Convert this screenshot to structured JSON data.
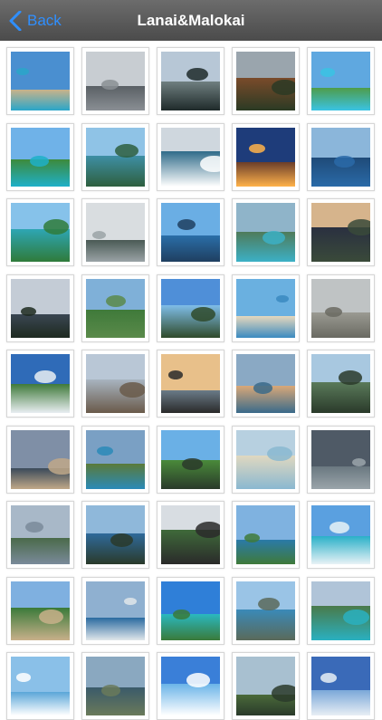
{
  "navbar": {
    "title": "Lanai&Malokai",
    "back_label": "Back",
    "back_icon": "chevron-left-icon",
    "accent_color": "#2f8fff"
  },
  "photos": [
    {
      "sky": "#4a8fd0",
      "land": "#c9b38a",
      "accent": "#2aa6c9"
    },
    {
      "sky": "#c8cdd2",
      "land": "#5a6065",
      "accent": "#8a8f94"
    },
    {
      "sky": "#b7c7d6",
      "land": "#6f7f80",
      "accent": "#1f2a2a"
    },
    {
      "sky": "#9aa5ad",
      "land": "#7a4b2a",
      "accent": "#2b3a24"
    },
    {
      "sky": "#5fa8e0",
      "land": "#4f9c4a",
      "accent": "#3ac3e3"
    },
    {
      "sky": "#6fb2e8",
      "land": "#3d8a3b",
      "accent": "#1fb0c8"
    },
    {
      "sky": "#8fc3e6",
      "land": "#3e8fa4",
      "accent": "#2e5f3e"
    },
    {
      "sky": "#cfd7de",
      "land": "#2f6b8a",
      "accent": "#ffffff"
    },
    {
      "sky": "#1e3c7a",
      "land": "#6b3e2a",
      "accent": "#ffb24a"
    },
    {
      "sky": "#8bb6da",
      "land": "#1f4a78",
      "accent": "#2a6aa8"
    },
    {
      "sky": "#86c2ea",
      "land": "#2ea6b4",
      "accent": "#2f7b3a"
    },
    {
      "sky": "#d9dde0",
      "land": "#4a5a55",
      "accent": "#9aa3a6"
    },
    {
      "sky": "#6aaee4",
      "land": "#2a6ea8",
      "accent": "#1f3f60"
    },
    {
      "sky": "#8fb4c9",
      "land": "#4f7b5a",
      "accent": "#3cb0c6"
    },
    {
      "sky": "#d6b48c",
      "land": "#2a3040",
      "accent": "#3a4a3a"
    },
    {
      "sky": "#c4ccd6",
      "land": "#3a4652",
      "accent": "#1e2a20"
    },
    {
      "sky": "#7fb0d8",
      "land": "#3f7a3a",
      "accent": "#5a8a4a"
    },
    {
      "sky": "#4f8fd8",
      "land": "#7fbde8",
      "accent": "#2f4a2a"
    },
    {
      "sky": "#6ab0e0",
      "land": "#e6d8bd",
      "accent": "#3a8ac0"
    },
    {
      "sky": "#bfc3c4",
      "land": "#9a9a92",
      "accent": "#6a6a62"
    },
    {
      "sky": "#2f6bb8",
      "land": "#3f7a3a",
      "accent": "#e9eef2"
    },
    {
      "sky": "#b9c7d6",
      "land": "#a8b4c0",
      "accent": "#6a5a4a"
    },
    {
      "sky": "#e8c08a",
      "land": "#6a7b88",
      "accent": "#2a2a2a"
    },
    {
      "sky": "#8aa9c4",
      "land": "#d9a878",
      "accent": "#3a6a8a"
    },
    {
      "sky": "#a8c8e0",
      "land": "#5a7a5a",
      "accent": "#2a3a2a"
    },
    {
      "sky": "#7f8fa6",
      "land": "#3a4a5a",
      "accent": "#c0a888"
    },
    {
      "sky": "#7aa0c4",
      "land": "#5a7a3a",
      "accent": "#2a8ab8"
    },
    {
      "sky": "#6ab0e6",
      "land": "#4a8a3a",
      "accent": "#2a3a2a"
    },
    {
      "sky": "#b7d0e0",
      "land": "#e0d8c0",
      "accent": "#8ab8d0"
    },
    {
      "sky": "#4f5a66",
      "land": "#6a7880",
      "accent": "#9aa4aa"
    },
    {
      "sky": "#a8b8c8",
      "land": "#4a6a4a",
      "accent": "#7a8a9a"
    },
    {
      "sky": "#8fb8da",
      "land": "#2f6a9a",
      "accent": "#2a3a2a"
    },
    {
      "sky": "#d8dde2",
      "land": "#3f6a3a",
      "accent": "#2a2a2a"
    },
    {
      "sky": "#7fb2e0",
      "land": "#2a7aa8",
      "accent": "#3f7a3a"
    },
    {
      "sky": "#5aa0e0",
      "land": "#2ab0c8",
      "accent": "#e8f2f6"
    },
    {
      "sky": "#7fb0e0",
      "land": "#3a7a3a",
      "accent": "#c8b08a"
    },
    {
      "sky": "#8fb0d0",
      "land": "#2a6aa0",
      "accent": "#e0e6ea"
    },
    {
      "sky": "#2f7fd8",
      "land": "#2ab8c0",
      "accent": "#3a7a3a"
    },
    {
      "sky": "#9ac4e6",
      "land": "#3a8ab8",
      "accent": "#5a6a5a"
    },
    {
      "sky": "#b0c4d8",
      "land": "#4a7a4a",
      "accent": "#2ab0c0"
    },
    {
      "sky": "#8ac0e8",
      "land": "#5aa6d8",
      "accent": "#ffffff"
    },
    {
      "sky": "#8aa8c0",
      "land": "#3a5a6a",
      "accent": "#6a7a5a"
    },
    {
      "sky": "#3a7fd8",
      "land": "#6ab4e8",
      "accent": "#ffffff"
    },
    {
      "sky": "#a8c0d0",
      "land": "#4a6a3a",
      "accent": "#2a3a2a"
    },
    {
      "sky": "#3a6ab8",
      "land": "#7aa8d8",
      "accent": "#e8eef4"
    }
  ]
}
